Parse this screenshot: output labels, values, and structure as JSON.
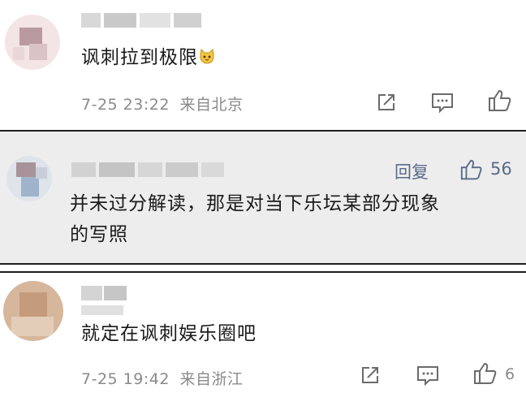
{
  "comments": [
    {
      "text": "讽刺拉到极限",
      "time": "7-25 23:22",
      "location": "来自北京"
    },
    {
      "reply_label": "回复",
      "like_count": "56",
      "text_line1": "并未过分解读，那是对当下乐坛某部分现象",
      "text_line2": "的写照"
    },
    {
      "text": "就定在讽刺娱乐圈吧",
      "time": "7-25 19:42",
      "location": "来自浙江",
      "like_count": "6"
    }
  ],
  "icons": {
    "share": "share-icon",
    "comment": "comment-icon",
    "like": "thumbs-up-icon",
    "emoji": "cat-face-emoji"
  },
  "colors": {
    "meta_text": "#8a8a8a",
    "link_text": "#5a6a8a",
    "highlight_bg": "#ededed",
    "divider": "#1e1e1e"
  }
}
